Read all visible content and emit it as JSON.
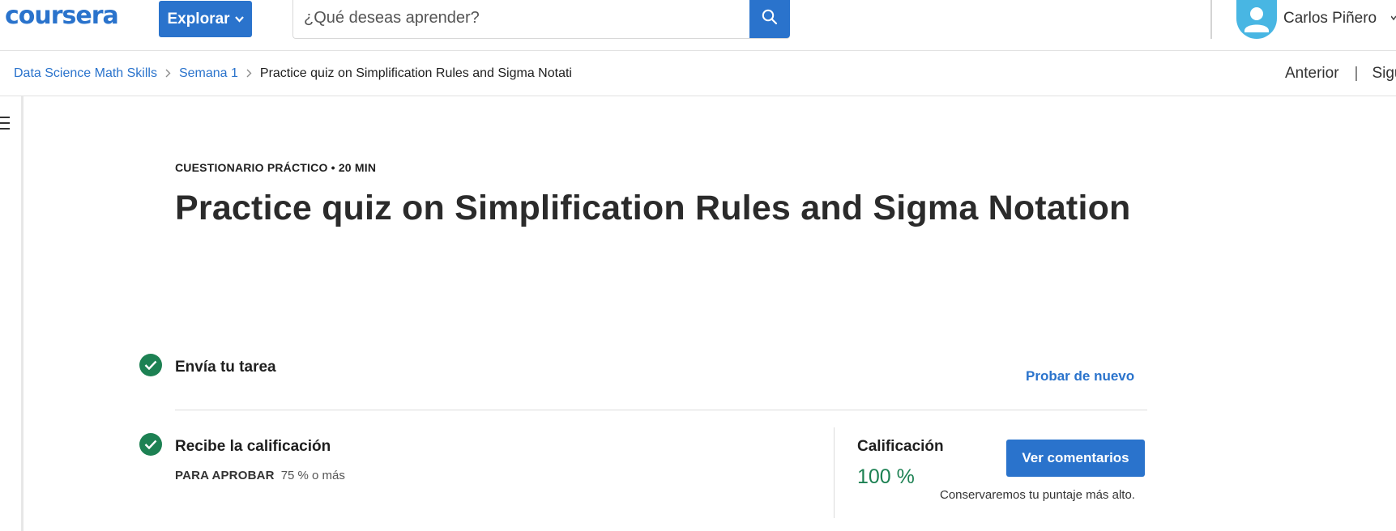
{
  "header": {
    "logo": "coursera",
    "explore_label": "Explorar",
    "search": {
      "placeholder": "¿Qué deseas aprender?",
      "value": ""
    },
    "user_name": "Carlos Piñero"
  },
  "breadcrumb": {
    "items": [
      "Data Science Math Skills",
      "Semana 1",
      "Practice quiz on Simplification Rules and Sigma Notati"
    ],
    "separator": ">"
  },
  "nav": {
    "previous": "Anterior",
    "next": "Sigu"
  },
  "quiz": {
    "kicker": "CUESTIONARIO PRÁCTICO • 20 MIN",
    "title": "Practice quiz on Simplification Rules and Sigma Notation",
    "step1": {
      "label": "Envía tu tarea",
      "action": "Probar de nuevo"
    },
    "step2": {
      "label": "Recibe la calificación",
      "pass_key": "PARA APROBAR",
      "pass_value": "75 % o más"
    },
    "grade": {
      "label": "Calificación",
      "value": "100 %",
      "button": "Ver comentarios",
      "note": "Conservaremos tu puntaje más alto."
    }
  },
  "colors": {
    "brand": "#2a73cc",
    "success": "#1d8153",
    "avatar": "#48b6e3"
  },
  "icons": [
    "search-icon",
    "chevron-down-icon",
    "user-avatar-icon",
    "menu-icon",
    "check-circle-icon"
  ]
}
